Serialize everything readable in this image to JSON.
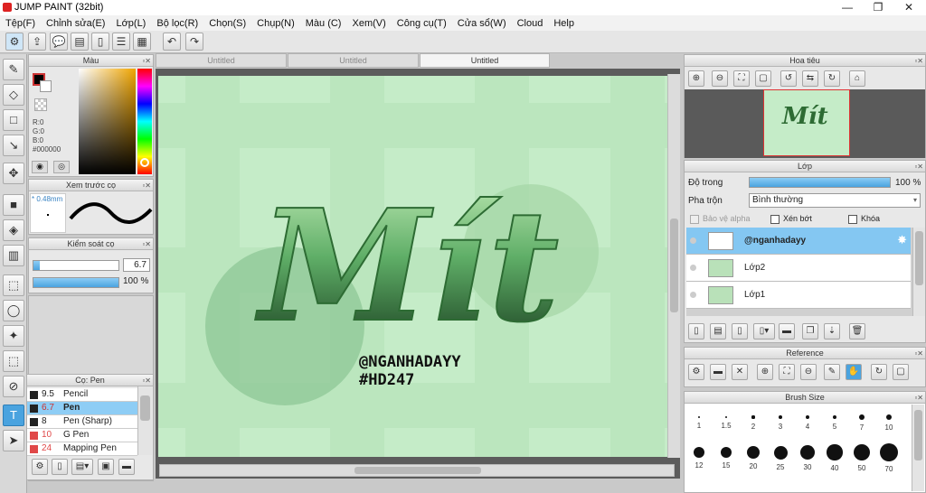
{
  "app": {
    "title": "JUMP PAINT (32bit)"
  },
  "window_controls": {
    "minimize": "—",
    "maximize": "❐",
    "close": "✕"
  },
  "menu": [
    "Tệp(F)",
    "Chỉnh sửa(E)",
    "Lớp(L)",
    "Bộ lọc(R)",
    "Chọn(S)",
    "Chụp(N)",
    "Màu (C)",
    "Xem(V)",
    "Công cụ(T)",
    "Cửa sổ(W)",
    "Cloud",
    "Help"
  ],
  "toolbar": {
    "icons": [
      "brush-settings-icon",
      "export-icon",
      "comment-icon",
      "message-icon",
      "page-icon",
      "list-icon",
      "layout-icon",
      "grid-icon"
    ],
    "undo": "↶",
    "redo": "↷"
  },
  "color_panel": {
    "title": "Màu",
    "r": "R:0",
    "g": "G:0",
    "b": "B:0",
    "hex": "#000000",
    "fg": "#000000",
    "bg": "#ffffff"
  },
  "brush_preview": {
    "title": "Xem trước cọ",
    "size": "* 0.48mm"
  },
  "brush_control": {
    "title": "Kiểm soát cọ",
    "size_value": "6.7",
    "opacity_value": "100 %",
    "size_fraction": 0.07,
    "opacity_fraction": 1.0
  },
  "brush_panel": {
    "title": "Cọ: Pen",
    "rows": [
      {
        "size": "9.5",
        "name": "Pencil",
        "color": "#222222"
      },
      {
        "size": "6.7",
        "name": "Pen",
        "color": "#222222",
        "selected": true
      },
      {
        "size": "8",
        "name": "Pen (Sharp)",
        "color": "#222222"
      },
      {
        "size": "10",
        "name": "G Pen",
        "color": "#e04848"
      },
      {
        "size": "24",
        "name": "Mapping Pen",
        "color": "#e04848"
      }
    ]
  },
  "tabs": [
    {
      "label": "Untitled",
      "active": false
    },
    {
      "label": "Untitled",
      "active": false
    },
    {
      "label": "Untitled",
      "active": true
    }
  ],
  "artwork": {
    "title_text": "Mít",
    "handle": "@NGANHADAYY",
    "tag": "#HD247",
    "bg": "#c5ecc8"
  },
  "navigator": {
    "title": "Hoa tiêu"
  },
  "layers": {
    "title": "Lớp",
    "opacity_label": "Độ trong",
    "opacity_value": "100 %",
    "opacity_fraction": 1.0,
    "blend_label": "Pha trộn",
    "blend_value": "Bình thường",
    "protect_alpha": "Bảo vệ alpha",
    "clipping": "Xén bớt",
    "lock": "Khóa",
    "items": [
      {
        "name": "@nganhadayy",
        "selected": true
      },
      {
        "name": "Lớp2",
        "selected": false
      },
      {
        "name": "Lớp1",
        "selected": false
      }
    ]
  },
  "reference": {
    "title": "Reference"
  },
  "brush_size": {
    "title": "Brush Size",
    "row1": [
      "1",
      "1.5",
      "2",
      "3",
      "4",
      "5",
      "7",
      "10"
    ],
    "row2": [
      "12",
      "15",
      "20",
      "25",
      "30",
      "40",
      "50",
      "70"
    ]
  }
}
